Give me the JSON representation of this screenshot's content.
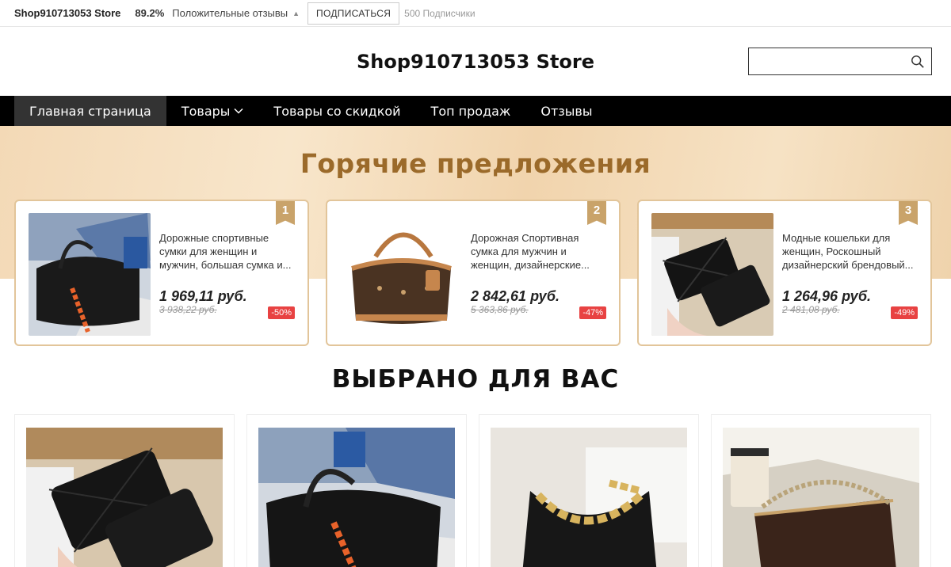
{
  "topbar": {
    "store_name": "Shop910713053 Store",
    "positive_pct": "89.2%",
    "positive_label": "Положительные отзывы",
    "subscribe_label": "ПОДПИСАТЬСЯ",
    "subscribers": "500 Подписчики"
  },
  "header": {
    "logo": "Shop910713053 Store",
    "search_placeholder": ""
  },
  "nav": {
    "items": [
      "Главная страница",
      "Товары",
      "Товары со скидкой",
      "Топ продаж",
      "Отзывы"
    ]
  },
  "hot": {
    "title": "Горячие предложения",
    "deals": [
      {
        "rank": "1",
        "name": "Дорожные спортивные сумки для женщин и мужчин, большая сумка и...",
        "price": "1 969,11 руб.",
        "old_price": "3 938,22 руб.",
        "discount": "-50%"
      },
      {
        "rank": "2",
        "name": "Дорожная Спортивная сумка для мужчин и женщин, дизайнерские...",
        "price": "2 842,61 руб.",
        "old_price": "5 363,86 руб.",
        "discount": "-47%"
      },
      {
        "rank": "3",
        "name": "Модные кошельки для женщин, Роскошный дизайнерский брендовый...",
        "price": "1 264,96 руб.",
        "old_price": "2 481,08 руб.",
        "discount": "-49%"
      }
    ]
  },
  "recommended": {
    "title": "ВЫБРАНО ДЛЯ ВАС"
  },
  "colors": {
    "accent_gold": "#9b6a2a",
    "badge_red": "#e84242",
    "nav_bg": "#000000"
  }
}
